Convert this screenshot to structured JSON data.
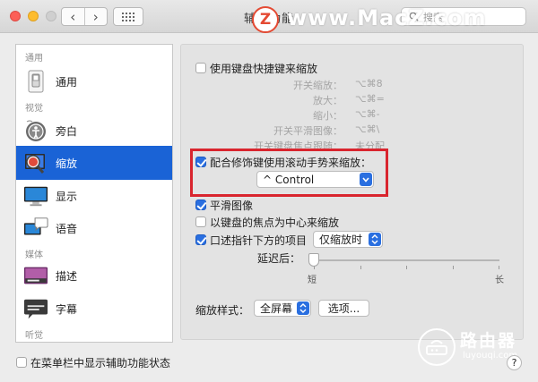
{
  "window": {
    "title": "辅助功能",
    "search_placeholder": "搜索"
  },
  "watermark": {
    "text": "www.MacZ.com",
    "logo_letter": "Z",
    "brand": "路由器",
    "brand_sub": "luyouqi.com"
  },
  "sidebar": {
    "sections": [
      "通用",
      "视觉",
      "媒体",
      "听觉"
    ],
    "items": [
      {
        "label": "通用",
        "icon": "switch-icon"
      },
      {
        "label": "旁白",
        "icon": "voiceover-icon"
      },
      {
        "label": "缩放",
        "icon": "zoom-icon",
        "active": true
      },
      {
        "label": "显示",
        "icon": "display-icon"
      },
      {
        "label": "语音",
        "icon": "speech-icon"
      },
      {
        "label": "描述",
        "icon": "descriptions-icon"
      },
      {
        "label": "字幕",
        "icon": "captions-icon"
      }
    ]
  },
  "zoom": {
    "use_keyboard_shortcuts": {
      "label": "使用键盘快捷键来缩放",
      "checked": false
    },
    "shortcuts": [
      {
        "label": "开关缩放：",
        "keys": "⌥⌘8"
      },
      {
        "label": "放大：",
        "keys": "⌥⌘="
      },
      {
        "label": "缩小：",
        "keys": "⌥⌘-"
      },
      {
        "label": "开关平滑图像：",
        "keys": "⌥⌘\\"
      },
      {
        "label": "开关键盘焦点跟随：",
        "keys": "未分配"
      }
    ],
    "scroll_gesture": {
      "label": "配合修饰键使用滚动手势来缩放：",
      "checked": true,
      "modifier": "^ Control"
    },
    "smooth_images": {
      "label": "平滑图像",
      "checked": true
    },
    "follow_focus": {
      "label": "以键盘的焦点为中心来缩放",
      "checked": false
    },
    "speak_under_pointer": {
      "label": "口述指针下方的项目",
      "checked": true,
      "mode": "仅缩放时"
    },
    "delay": {
      "label": "延迟后：",
      "min_label": "短",
      "max_label": "长",
      "value": 0
    },
    "style": {
      "label": "缩放样式：",
      "value": "全屏幕",
      "options_button": "选项..."
    }
  },
  "footer": {
    "show_in_menubar": {
      "label": "在菜单栏中显示辅助功能状态",
      "checked": false
    },
    "help": "?"
  },
  "colors": {
    "accent": "#2a6fe0",
    "selection": "#1a63d6",
    "highlight_box": "#d9252e"
  }
}
